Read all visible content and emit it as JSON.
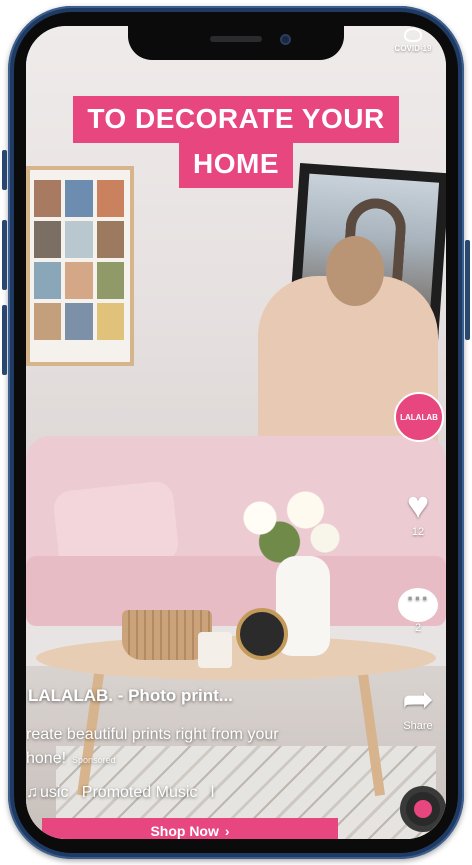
{
  "status": {
    "covid_label": "COVID-19"
  },
  "ad": {
    "headline_line1": "TO DECORATE YOUR",
    "headline_line2": "HOME"
  },
  "creator": {
    "avatar_text": "LALALAB"
  },
  "actions": {
    "like_count": "12",
    "comment_count": "2",
    "share_label": "Share"
  },
  "caption": {
    "account": "LALALAB. - Photo print...",
    "desc_line1": "reate beautiful prints right from your",
    "desc_line2": "hone!",
    "sponsored": "Sponsored",
    "music_prefix": "usic",
    "music_title": "Promoted Music",
    "music_sep": "l"
  },
  "cta": {
    "label": "Shop Now",
    "chevron": "›"
  },
  "colors": {
    "accent": "#e8467f",
    "frame": "#1f3b63"
  }
}
